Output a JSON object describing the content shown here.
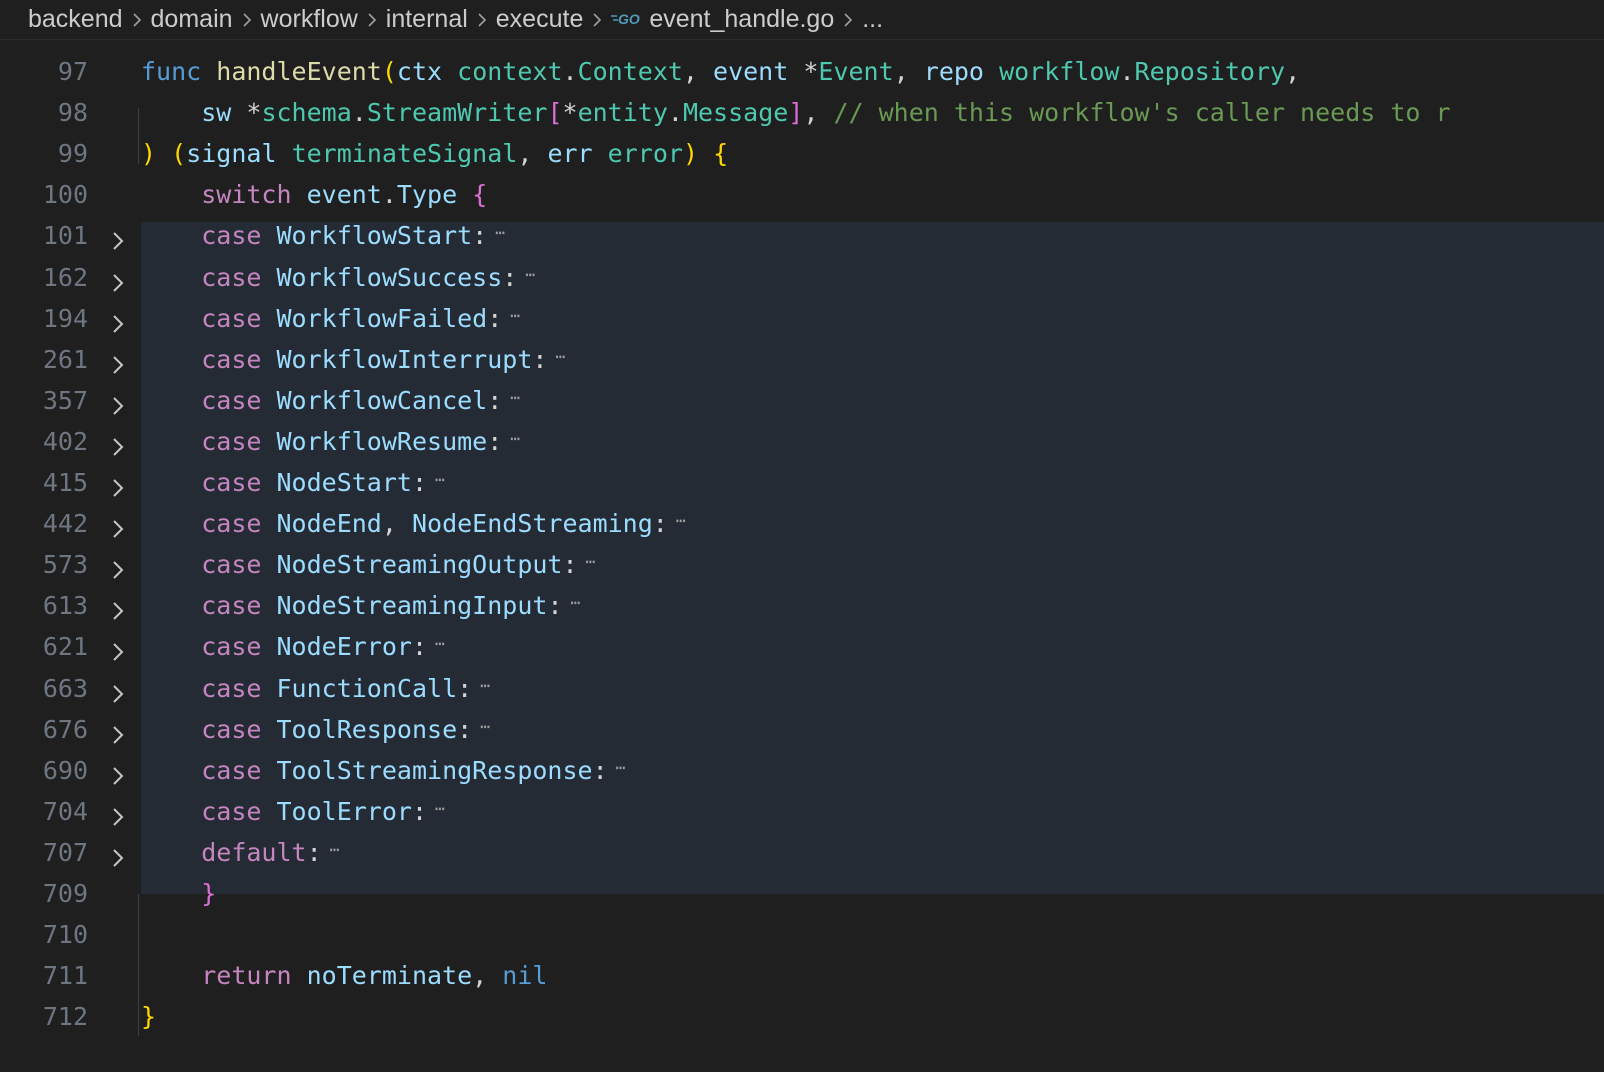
{
  "breadcrumb": {
    "items": [
      "backend",
      "domain",
      "workflow",
      "internal",
      "execute",
      "event_handle.go",
      "..."
    ],
    "file_icon": "go-file-icon"
  },
  "editor": {
    "lines": [
      {
        "num": "97",
        "fold": false,
        "tokens": [
          {
            "t": "func",
            "c": "kw"
          },
          {
            "t": " ",
            "c": "plain"
          },
          {
            "t": "handleEvent",
            "c": "fn"
          },
          {
            "t": "(",
            "c": "brk-y"
          },
          {
            "t": "ctx",
            "c": "var"
          },
          {
            "t": " ",
            "c": "plain"
          },
          {
            "t": "context",
            "c": "typ"
          },
          {
            "t": ".",
            "c": "plain"
          },
          {
            "t": "Context",
            "c": "typ"
          },
          {
            "t": ", ",
            "c": "plain"
          },
          {
            "t": "event",
            "c": "var"
          },
          {
            "t": " *",
            "c": "plain"
          },
          {
            "t": "Event",
            "c": "typ"
          },
          {
            "t": ", ",
            "c": "plain"
          },
          {
            "t": "repo",
            "c": "var"
          },
          {
            "t": " ",
            "c": "plain"
          },
          {
            "t": "workflow",
            "c": "typ"
          },
          {
            "t": ".",
            "c": "plain"
          },
          {
            "t": "Repository",
            "c": "typ"
          },
          {
            "t": ",",
            "c": "plain"
          }
        ]
      },
      {
        "num": "98",
        "fold": false,
        "tokens": [
          {
            "t": "    ",
            "c": "plain"
          },
          {
            "t": "sw",
            "c": "var"
          },
          {
            "t": " *",
            "c": "plain"
          },
          {
            "t": "schema",
            "c": "typ"
          },
          {
            "t": ".",
            "c": "plain"
          },
          {
            "t": "StreamWriter",
            "c": "typ"
          },
          {
            "t": "[",
            "c": "brk-p"
          },
          {
            "t": "*",
            "c": "plain"
          },
          {
            "t": "entity",
            "c": "typ"
          },
          {
            "t": ".",
            "c": "plain"
          },
          {
            "t": "Message",
            "c": "typ"
          },
          {
            "t": "]",
            "c": "brk-p"
          },
          {
            "t": ", ",
            "c": "plain"
          },
          {
            "t": "// when this workflow's caller needs to r",
            "c": "cmt"
          }
        ]
      },
      {
        "num": "99",
        "fold": false,
        "tokens": [
          {
            "t": ")",
            "c": "brk-y"
          },
          {
            "t": " ",
            "c": "plain"
          },
          {
            "t": "(",
            "c": "brk-y"
          },
          {
            "t": "signal",
            "c": "var"
          },
          {
            "t": " ",
            "c": "plain"
          },
          {
            "t": "terminateSignal",
            "c": "typ"
          },
          {
            "t": ", ",
            "c": "plain"
          },
          {
            "t": "err",
            "c": "var"
          },
          {
            "t": " ",
            "c": "plain"
          },
          {
            "t": "error",
            "c": "typ"
          },
          {
            "t": ")",
            "c": "brk-y"
          },
          {
            "t": " ",
            "c": "plain"
          },
          {
            "t": "{",
            "c": "brk-y"
          }
        ]
      },
      {
        "num": "100",
        "fold": false,
        "tokens": [
          {
            "t": "    ",
            "c": "plain"
          },
          {
            "t": "switch",
            "c": "ctl"
          },
          {
            "t": " ",
            "c": "plain"
          },
          {
            "t": "event",
            "c": "var"
          },
          {
            "t": ".",
            "c": "plain"
          },
          {
            "t": "Type",
            "c": "var"
          },
          {
            "t": " ",
            "c": "plain"
          },
          {
            "t": "{",
            "c": "brk-p"
          }
        ]
      },
      {
        "num": "101",
        "fold": true,
        "tokens": [
          {
            "t": "    ",
            "c": "plain"
          },
          {
            "t": "case",
            "c": "ctl"
          },
          {
            "t": " ",
            "c": "plain"
          },
          {
            "t": "WorkflowStart",
            "c": "var"
          },
          {
            "t": ":",
            "c": "plain"
          }
        ],
        "ellipsis": "⋯"
      },
      {
        "num": "162",
        "fold": true,
        "tokens": [
          {
            "t": "    ",
            "c": "plain"
          },
          {
            "t": "case",
            "c": "ctl"
          },
          {
            "t": " ",
            "c": "plain"
          },
          {
            "t": "WorkflowSuccess",
            "c": "var"
          },
          {
            "t": ":",
            "c": "plain"
          }
        ],
        "ellipsis": "⋯"
      },
      {
        "num": "194",
        "fold": true,
        "tokens": [
          {
            "t": "    ",
            "c": "plain"
          },
          {
            "t": "case",
            "c": "ctl"
          },
          {
            "t": " ",
            "c": "plain"
          },
          {
            "t": "WorkflowFailed",
            "c": "var"
          },
          {
            "t": ":",
            "c": "plain"
          }
        ],
        "ellipsis": "⋯"
      },
      {
        "num": "261",
        "fold": true,
        "tokens": [
          {
            "t": "    ",
            "c": "plain"
          },
          {
            "t": "case",
            "c": "ctl"
          },
          {
            "t": " ",
            "c": "plain"
          },
          {
            "t": "WorkflowInterrupt",
            "c": "var"
          },
          {
            "t": ":",
            "c": "plain"
          }
        ],
        "ellipsis": "⋯"
      },
      {
        "num": "357",
        "fold": true,
        "tokens": [
          {
            "t": "    ",
            "c": "plain"
          },
          {
            "t": "case",
            "c": "ctl"
          },
          {
            "t": " ",
            "c": "plain"
          },
          {
            "t": "WorkflowCancel",
            "c": "var"
          },
          {
            "t": ":",
            "c": "plain"
          }
        ],
        "ellipsis": "⋯"
      },
      {
        "num": "402",
        "fold": true,
        "tokens": [
          {
            "t": "    ",
            "c": "plain"
          },
          {
            "t": "case",
            "c": "ctl"
          },
          {
            "t": " ",
            "c": "plain"
          },
          {
            "t": "WorkflowResume",
            "c": "var"
          },
          {
            "t": ":",
            "c": "plain"
          }
        ],
        "ellipsis": "⋯"
      },
      {
        "num": "415",
        "fold": true,
        "tokens": [
          {
            "t": "    ",
            "c": "plain"
          },
          {
            "t": "case",
            "c": "ctl"
          },
          {
            "t": " ",
            "c": "plain"
          },
          {
            "t": "NodeStart",
            "c": "var"
          },
          {
            "t": ":",
            "c": "plain"
          }
        ],
        "ellipsis": "⋯"
      },
      {
        "num": "442",
        "fold": true,
        "tokens": [
          {
            "t": "    ",
            "c": "plain"
          },
          {
            "t": "case",
            "c": "ctl"
          },
          {
            "t": " ",
            "c": "plain"
          },
          {
            "t": "NodeEnd",
            "c": "var"
          },
          {
            "t": ", ",
            "c": "plain"
          },
          {
            "t": "NodeEndStreaming",
            "c": "var"
          },
          {
            "t": ":",
            "c": "plain"
          }
        ],
        "ellipsis": "⋯"
      },
      {
        "num": "573",
        "fold": true,
        "tokens": [
          {
            "t": "    ",
            "c": "plain"
          },
          {
            "t": "case",
            "c": "ctl"
          },
          {
            "t": " ",
            "c": "plain"
          },
          {
            "t": "NodeStreamingOutput",
            "c": "var"
          },
          {
            "t": ":",
            "c": "plain"
          }
        ],
        "ellipsis": "⋯"
      },
      {
        "num": "613",
        "fold": true,
        "tokens": [
          {
            "t": "    ",
            "c": "plain"
          },
          {
            "t": "case",
            "c": "ctl"
          },
          {
            "t": " ",
            "c": "plain"
          },
          {
            "t": "NodeStreamingInput",
            "c": "var"
          },
          {
            "t": ":",
            "c": "plain"
          }
        ],
        "ellipsis": "⋯"
      },
      {
        "num": "621",
        "fold": true,
        "tokens": [
          {
            "t": "    ",
            "c": "plain"
          },
          {
            "t": "case",
            "c": "ctl"
          },
          {
            "t": " ",
            "c": "plain"
          },
          {
            "t": "NodeError",
            "c": "var"
          },
          {
            "t": ":",
            "c": "plain"
          }
        ],
        "ellipsis": "⋯"
      },
      {
        "num": "663",
        "fold": true,
        "tokens": [
          {
            "t": "    ",
            "c": "plain"
          },
          {
            "t": "case",
            "c": "ctl"
          },
          {
            "t": " ",
            "c": "plain"
          },
          {
            "t": "FunctionCall",
            "c": "var"
          },
          {
            "t": ":",
            "c": "plain"
          }
        ],
        "ellipsis": "⋯"
      },
      {
        "num": "676",
        "fold": true,
        "tokens": [
          {
            "t": "    ",
            "c": "plain"
          },
          {
            "t": "case",
            "c": "ctl"
          },
          {
            "t": " ",
            "c": "plain"
          },
          {
            "t": "ToolResponse",
            "c": "var"
          },
          {
            "t": ":",
            "c": "plain"
          }
        ],
        "ellipsis": "⋯"
      },
      {
        "num": "690",
        "fold": true,
        "tokens": [
          {
            "t": "    ",
            "c": "plain"
          },
          {
            "t": "case",
            "c": "ctl"
          },
          {
            "t": " ",
            "c": "plain"
          },
          {
            "t": "ToolStreamingResponse",
            "c": "var"
          },
          {
            "t": ":",
            "c": "plain"
          }
        ],
        "ellipsis": "⋯"
      },
      {
        "num": "704",
        "fold": true,
        "tokens": [
          {
            "t": "    ",
            "c": "plain"
          },
          {
            "t": "case",
            "c": "ctl"
          },
          {
            "t": " ",
            "c": "plain"
          },
          {
            "t": "ToolError",
            "c": "var"
          },
          {
            "t": ":",
            "c": "plain"
          }
        ],
        "ellipsis": "⋯"
      },
      {
        "num": "707",
        "fold": true,
        "tokens": [
          {
            "t": "    ",
            "c": "plain"
          },
          {
            "t": "default",
            "c": "ctl"
          },
          {
            "t": ":",
            "c": "plain"
          }
        ],
        "ellipsis": "⋯"
      },
      {
        "num": "709",
        "fold": false,
        "tokens": [
          {
            "t": "    ",
            "c": "plain"
          },
          {
            "t": "}",
            "c": "brk-p"
          }
        ]
      },
      {
        "num": "710",
        "fold": false,
        "tokens": []
      },
      {
        "num": "711",
        "fold": false,
        "tokens": [
          {
            "t": "    ",
            "c": "plain"
          },
          {
            "t": "return",
            "c": "ctl"
          },
          {
            "t": " ",
            "c": "plain"
          },
          {
            "t": "noTerminate",
            "c": "var"
          },
          {
            "t": ", ",
            "c": "plain"
          },
          {
            "t": "nil",
            "c": "kw"
          }
        ]
      },
      {
        "num": "712",
        "fold": false,
        "tokens": [
          {
            "t": "}",
            "c": "brk-y"
          }
        ]
      }
    ]
  },
  "colors": {
    "background": "#1f1f1f",
    "highlight": "#252b35",
    "keyword": "#569cd6",
    "control": "#c586c0",
    "function": "#dcdcaa",
    "variable": "#9cdcfe",
    "type": "#4ec9b0",
    "comment": "#6a9955"
  }
}
